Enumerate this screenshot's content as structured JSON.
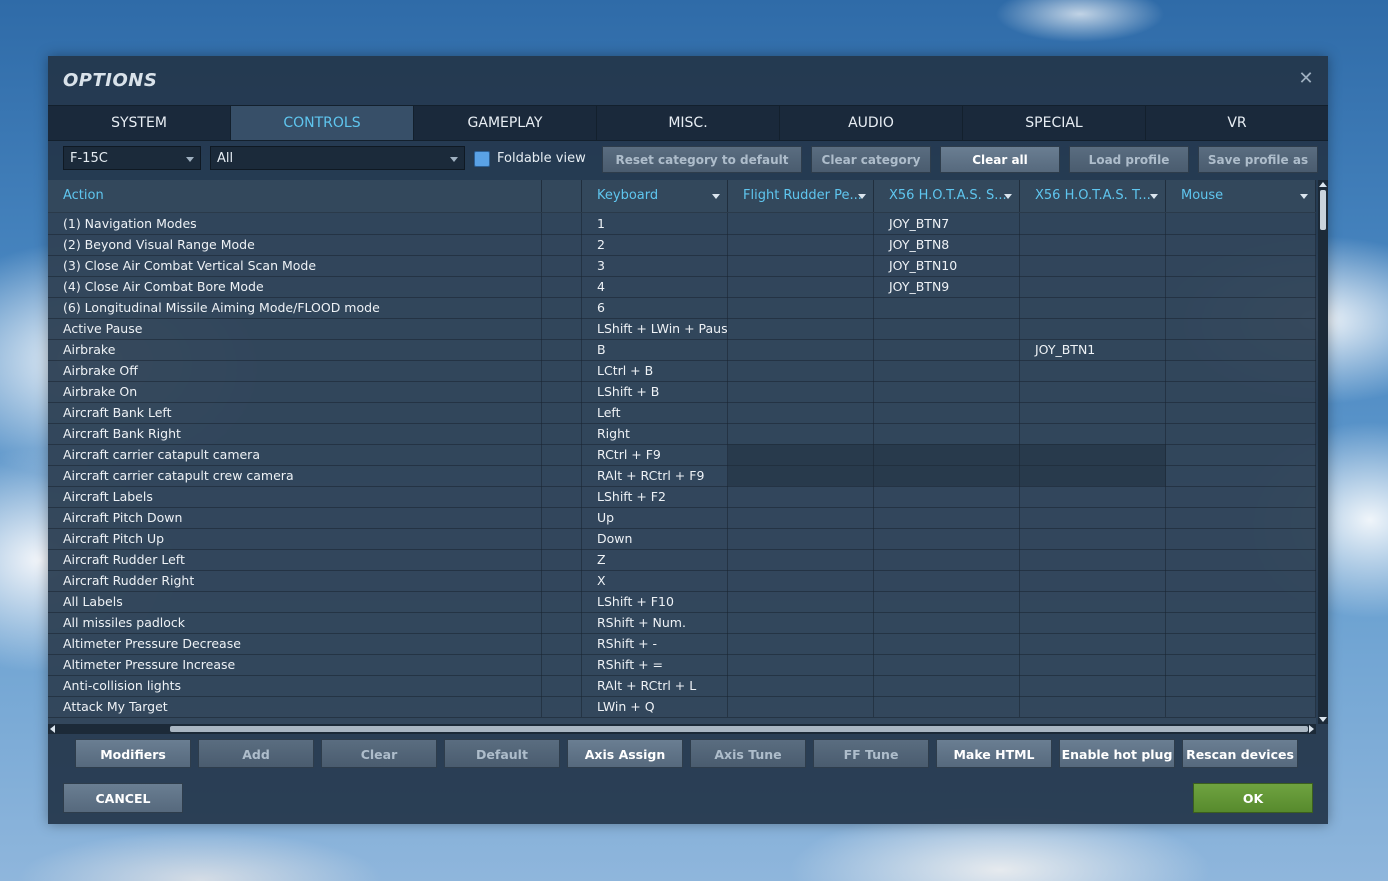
{
  "dialog": {
    "title": "OPTIONS",
    "close_glyph": "✕"
  },
  "tabs": [
    {
      "label": "SYSTEM",
      "active": false
    },
    {
      "label": "CONTROLS",
      "active": true
    },
    {
      "label": "GAMEPLAY",
      "active": false
    },
    {
      "label": "MISC.",
      "active": false
    },
    {
      "label": "AUDIO",
      "active": false
    },
    {
      "label": "SPECIAL",
      "active": false
    },
    {
      "label": "VR",
      "active": false
    }
  ],
  "toolbar": {
    "aircraft_select": "F-15C",
    "category_select": "All",
    "foldable_view_label": "Foldable view",
    "foldable_view_checked": true,
    "reset_category": "Reset category to default",
    "clear_category": "Clear category",
    "clear_all": "Clear all",
    "load_profile": "Load profile",
    "save_profile_as": "Save profile as"
  },
  "columns": [
    "Action",
    "Keyboard",
    "Flight Rudder Pe...",
    "X56 H.O.T.A.S. S...",
    "X56 H.O.T.A.S. T...",
    "Mouse"
  ],
  "rows": [
    [
      "(1) Navigation Modes",
      "1",
      "",
      "JOY_BTN7",
      "",
      ""
    ],
    [
      "(2) Beyond Visual Range Mode",
      "2",
      "",
      "JOY_BTN8",
      "",
      ""
    ],
    [
      "(3) Close Air Combat Vertical Scan Mode",
      "3",
      "",
      "JOY_BTN10",
      "",
      ""
    ],
    [
      "(4) Close Air Combat Bore Mode",
      "4",
      "",
      "JOY_BTN9",
      "",
      ""
    ],
    [
      "(6) Longitudinal Missile Aiming Mode/FLOOD mode",
      "6",
      "",
      "",
      "",
      ""
    ],
    [
      "Active Pause",
      "LShift + LWin + Pause",
      "",
      "",
      "",
      ""
    ],
    [
      "Airbrake",
      "B",
      "",
      "",
      "JOY_BTN1",
      ""
    ],
    [
      "Airbrake Off",
      "LCtrl + B",
      "",
      "",
      "",
      ""
    ],
    [
      "Airbrake On",
      "LShift + B",
      "",
      "",
      "",
      ""
    ],
    [
      "Aircraft Bank Left",
      "Left",
      "",
      "",
      "",
      ""
    ],
    [
      "Aircraft Bank Right",
      "Right",
      "",
      "",
      "",
      ""
    ],
    [
      "Aircraft carrier catapult camera",
      "RCtrl + F9",
      "",
      "",
      "",
      ""
    ],
    [
      "Aircraft carrier catapult crew camera",
      "RAlt + RCtrl + F9",
      "",
      "",
      "",
      ""
    ],
    [
      "Aircraft Labels",
      "LShift + F2",
      "",
      "",
      "",
      ""
    ],
    [
      "Aircraft Pitch Down",
      "Up",
      "",
      "",
      "",
      ""
    ],
    [
      "Aircraft Pitch Up",
      "Down",
      "",
      "",
      "",
      ""
    ],
    [
      "Aircraft Rudder Left",
      "Z",
      "",
      "",
      "",
      ""
    ],
    [
      "Aircraft Rudder Right",
      "X",
      "",
      "",
      "",
      ""
    ],
    [
      "All Labels",
      "LShift + F10",
      "",
      "",
      "",
      ""
    ],
    [
      "All missiles padlock",
      "RShift + Num.",
      "",
      "",
      "",
      ""
    ],
    [
      "Altimeter Pressure Decrease",
      "RShift + -",
      "",
      "",
      "",
      ""
    ],
    [
      "Altimeter Pressure Increase",
      "RShift + =",
      "",
      "",
      "",
      ""
    ],
    [
      "Anti-collision lights",
      "RAlt + RCtrl + L",
      "",
      "",
      "",
      ""
    ],
    [
      "Attack My Target",
      "LWin + Q",
      "",
      "",
      "",
      ""
    ]
  ],
  "bottom_buttons": [
    {
      "label": "Modifiers",
      "bright": true
    },
    {
      "label": "Add",
      "bright": false
    },
    {
      "label": "Clear",
      "bright": false
    },
    {
      "label": "Default",
      "bright": false
    },
    {
      "label": "Axis Assign",
      "bright": true
    },
    {
      "label": "Axis Tune",
      "bright": false
    },
    {
      "label": "FF Tune",
      "bright": false
    },
    {
      "label": "Make HTML",
      "bright": true
    },
    {
      "label": "Enable hot plug",
      "bright": true
    },
    {
      "label": "Rescan devices",
      "bright": true
    }
  ],
  "footer": {
    "cancel": "CANCEL",
    "ok": "OK"
  },
  "colors": {
    "accent": "#5fc6ef",
    "ok_green": "#6fa340",
    "panel": "#24364a"
  }
}
